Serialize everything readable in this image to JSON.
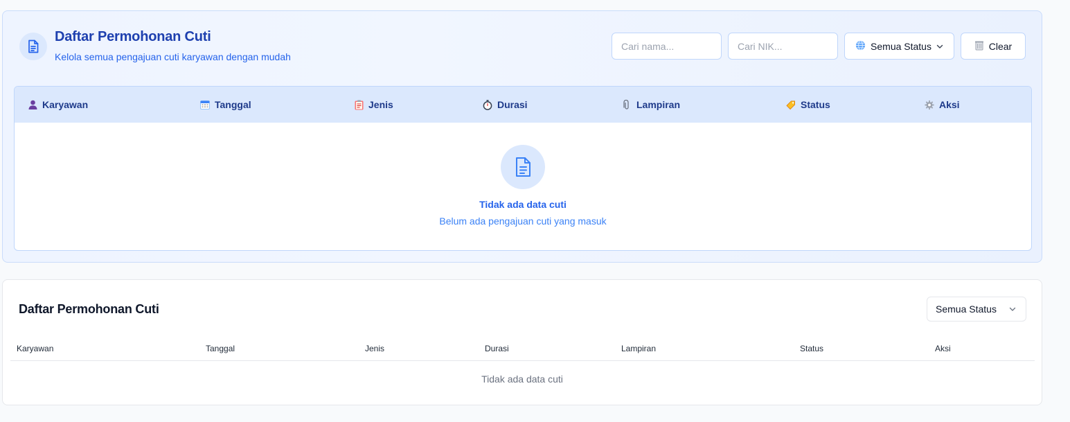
{
  "header": {
    "title": "Daftar Permohonan Cuti",
    "subtitle": "Kelola semua pengajuan cuti karyawan dengan mudah",
    "icon": "document-icon"
  },
  "filters": {
    "name_placeholder": "Cari nama...",
    "nik_placeholder": "Cari NIK...",
    "status_label": "Semua Status",
    "clear_label": "Clear"
  },
  "table1": {
    "columns": [
      {
        "label": "Karyawan",
        "icon": "user-icon"
      },
      {
        "label": "Tanggal",
        "icon": "calendar-icon"
      },
      {
        "label": "Jenis",
        "icon": "clipboard-icon"
      },
      {
        "label": "Durasi",
        "icon": "stopwatch-icon"
      },
      {
        "label": "Lampiran",
        "icon": "paperclip-icon"
      },
      {
        "label": "Status",
        "icon": "tag-icon"
      },
      {
        "label": "Aksi",
        "icon": "gear-icon"
      }
    ],
    "empty_title": "Tidak ada data cuti",
    "empty_subtitle": "Belum ada pengajuan cuti yang masuk"
  },
  "card2": {
    "title": "Daftar Permohonan Cuti",
    "status_select": "Semua Status",
    "columns": [
      "Karyawan",
      "Tanggal",
      "Jenis",
      "Durasi",
      "Lampiran",
      "Status",
      "Aksi"
    ],
    "empty_text": "Tidak ada data cuti"
  },
  "colors": {
    "accent": "#1e40af",
    "accent_light": "#dbe8fd",
    "border": "#bfd6fb"
  }
}
